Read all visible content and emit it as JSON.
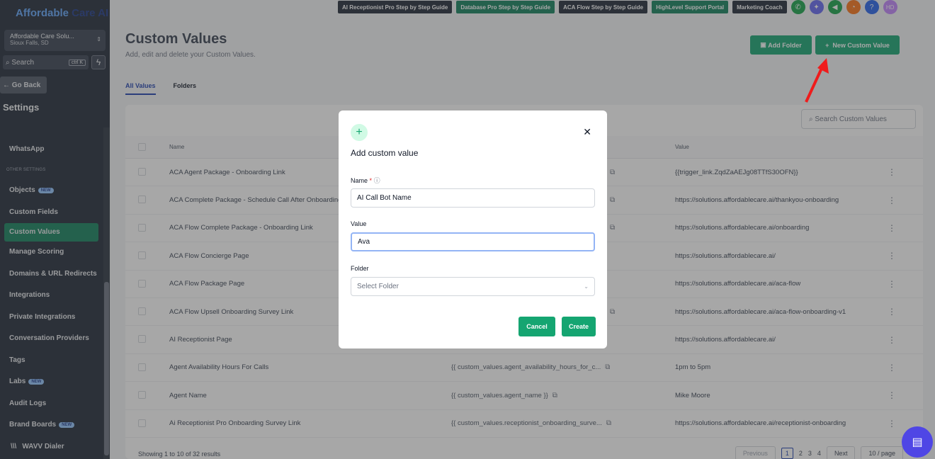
{
  "sidebar": {
    "logo_a": "Affordable",
    "logo_b": "Care AI",
    "account_name": "Affordable Care Solu...",
    "account_location": "Sioux Falls, SD",
    "search_label": "Search",
    "search_shortcut": "ctrl K",
    "go_back": "← Go Back",
    "settings_heading": "Settings",
    "items": [
      {
        "label": "WhatsApp"
      },
      {
        "label": "OTHER SETTINGS",
        "group": true
      },
      {
        "label": "Objects",
        "badge": "NEW"
      },
      {
        "label": "Custom Fields"
      },
      {
        "label": "Custom Values",
        "active": true
      },
      {
        "label": "Manage Scoring"
      },
      {
        "label": "Domains & URL Redirects"
      },
      {
        "label": "Integrations"
      },
      {
        "label": "Private Integrations"
      },
      {
        "label": "Conversation Providers"
      },
      {
        "label": "Tags"
      },
      {
        "label": "Labs",
        "badge": "NEW"
      },
      {
        "label": "Audit Logs"
      },
      {
        "label": "Brand Boards",
        "badge": "NEW"
      },
      {
        "label": "WAVV Dialer"
      }
    ]
  },
  "topbar": {
    "links": [
      {
        "label": "AI Receptionist Pro Step by Step Guide",
        "style": "dark"
      },
      {
        "label": "Database Pro Step by Step Guide",
        "style": "green"
      },
      {
        "label": "ACA Flow Step by Step Guide",
        "style": "dark"
      },
      {
        "label": "HighLevel Support Portal",
        "style": "green"
      },
      {
        "label": "Marketing Coach",
        "style": "dark"
      }
    ],
    "avatar_initials": "HD"
  },
  "page": {
    "title": "Custom Values",
    "subtitle": "Add, edit and delete your Custom Values.",
    "add_folder": "Add Folder",
    "new_custom_value": "New Custom Value",
    "tabs": [
      "All Values",
      "Folders"
    ],
    "search_placeholder": "Search Custom Values",
    "col_name": "Name",
    "col_value": "Value",
    "rows": [
      {
        "name": "ACA Agent Package - Onboarding Link",
        "key": "",
        "value": "{{trigger_link.ZqdZaAEJg08TTfS30OFN}}"
      },
      {
        "name": "ACA Complete Package - Schedule Call After Onboarding",
        "key": "",
        "value": "https://solutions.affordablecare.ai/thankyou-onboarding"
      },
      {
        "name": "ACA Flow Complete Package - Onboarding Link",
        "key": "",
        "value": "https://solutions.affordablecare.ai/onboarding"
      },
      {
        "name": "ACA Flow Concierge Page",
        "key": "",
        "value": "https://solutions.affordablecare.ai/"
      },
      {
        "name": "ACA Flow Package Page",
        "key": "",
        "value": "https://solutions.affordablecare.ai/aca-flow"
      },
      {
        "name": "ACA Flow Upsell Onboarding Survey Link",
        "key": "",
        "value": "https://solutions.affordablecare.ai/aca-flow-onboarding-v1"
      },
      {
        "name": "AI Receptionist Page",
        "key": "",
        "value": "https://solutions.affordablecare.ai/"
      },
      {
        "name": "Agent Availability Hours For Calls",
        "key": "{{ custom_values.agent_availability_hours_for_c...",
        "value": "1pm to 5pm"
      },
      {
        "name": "Agent Name",
        "key": "{{ custom_values.agent_name }}",
        "value": "Mike Moore"
      },
      {
        "name": "Ai Receptionist Pro Onboarding Survey Link",
        "key": "{{ custom_values.receptionist_onboarding_surve...",
        "value": "https://solutions.affordablecare.ai/receptionist-onboarding"
      }
    ],
    "showing": "Showing 1 to 10 of 32 results",
    "previous": "Previous",
    "next": "Next",
    "pages": [
      "1",
      "2",
      "3",
      "4"
    ],
    "per_page": "10 / page"
  },
  "modal": {
    "title": "Add custom value",
    "name_label": "Name",
    "name_value": "AI Call Bot Name",
    "value_label": "Value",
    "value_value": "Ava",
    "folder_label": "Folder",
    "folder_placeholder": "Select Folder",
    "cancel": "Cancel",
    "create": "Create"
  }
}
